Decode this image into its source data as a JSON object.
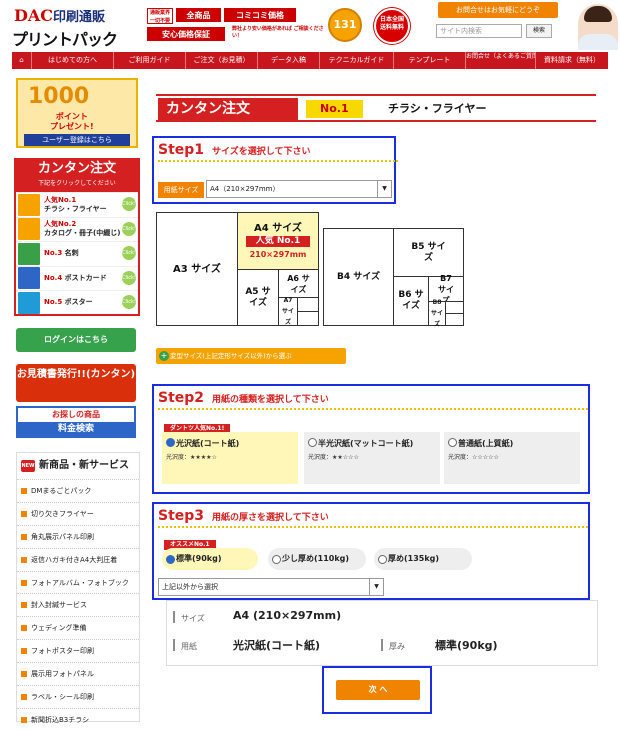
{
  "header": {
    "logo_line1_a": "DAC",
    "logo_line1_b": "印刷通販",
    "logo_line2": "プリントパック",
    "badge_small": "通販業界一切不要",
    "badge_all": "全商品",
    "badge_comikomi": "コミコミ価格",
    "badge_guarantee": "安心価格保証",
    "guarantee_note": "弊社より安い価格があれば ご相談ください！",
    "medal_number": "131",
    "medal2_text": "日本全国 送料無料",
    "contact_button": "お問合せはお気軽にどうぞ",
    "search_placeholder": "サイト内検索",
    "search_button": "検索"
  },
  "nav": {
    "items": [
      {
        "label": "はじめての方へ"
      },
      {
        "label": "ご利用ガイド"
      },
      {
        "label": "ご注文（お見積）"
      },
      {
        "label": "データ入稿"
      },
      {
        "label": "テクニカルガイド"
      },
      {
        "label": "テンプレート"
      },
      {
        "label": "お問合せ（よくあるご質問）"
      },
      {
        "label": "資料請求（無料）"
      }
    ]
  },
  "sidebar": {
    "points_number": "1000",
    "points_unit": "ポイント",
    "points_gift": "プレゼント!",
    "register_label": "ユーザー登録はこちら",
    "kantan_title": "カンタン注文",
    "kantan_sub": "下記をクリックしてください",
    "kantan_items": [
      {
        "rank": "人気No.1",
        "label": "チラシ・フライヤー"
      },
      {
        "rank": "人気No.2",
        "label": "カタログ・冊子(中綴じ)"
      },
      {
        "rank": "No.3",
        "label": "名刺"
      },
      {
        "rank": "No.4",
        "label": "ポストカード"
      },
      {
        "rank": "No.5",
        "label": "ポスター"
      }
    ],
    "click_label": "Click!",
    "login_label": "ログインはこちら",
    "quote_label": "お見積書発行!!(カンタン)",
    "search_product_a": "お探しの商品",
    "search_product_b": "料金検索",
    "new_badge": "NEW",
    "new_services_title": "新商品・新サービス",
    "new_services": [
      "DMまるごとパック",
      "切り欠きフライヤー",
      "角丸展示パネル印刷",
      "返信ハガキ付きA4大判圧着",
      "フォトアルバム・フォトブック",
      "封入封緘サービス",
      "ウェディング準備",
      "フォトポスター印刷",
      "展示用フォトパネル",
      "ラベル・シール印刷",
      "新聞折込B3チラシ"
    ]
  },
  "main": {
    "title": "カンタン注文",
    "title_badge": "No.1",
    "title_product": "チラシ・フライヤー",
    "step1": {
      "num": "Step1",
      "desc": "サイズを選択して下さい",
      "label": "用紙サイズ",
      "value": "A4（210×297mm）"
    },
    "sizes": {
      "a3": "A3 サイズ",
      "a4": "A4 サイズ",
      "a4_popular": "人気 No.1",
      "a4_mm": "210×297mm",
      "a5": "A5 サイズ",
      "a6": "A6 サイズ",
      "a7": "A7 サイズ",
      "b4": "B4 サイズ",
      "b5": "B5 サイズ",
      "b6": "B6 サイズ",
      "b7": "B7 サイズ",
      "b8": "B8 サイズ"
    },
    "variant_button": "変型サイズ(上記定形サイズ以外)から選ぶ",
    "step2": {
      "num": "Step2",
      "desc": "用紙の種類を選択して下さい",
      "ribbon": "ダントツ人気No.1!",
      "papers": [
        {
          "name": "光沢紙(コート紙)",
          "gloss": "光沢度：★★★★☆"
        },
        {
          "name": "半光沢紙(マットコート紙)",
          "gloss": "光沢度：★★☆☆☆"
        },
        {
          "name": "普通紙(上質紙)",
          "gloss": "光沢度：☆☆☆☆☆"
        }
      ]
    },
    "step3": {
      "num": "Step3",
      "desc": "用紙の厚さを選択して下さい",
      "ribbon": "オススメNo.1",
      "options": [
        "標準(90kg)",
        "少し厚め(110kg)",
        "厚め(135kg)"
      ],
      "other_select": "上記以外から選択"
    },
    "summary": {
      "size_label": "サイズ",
      "size_value": "A4 (210×297mm)",
      "paper_label": "用紙",
      "paper_value": "光沢紙(コート紙)",
      "thick_label": "厚み",
      "thick_value": "標準(90kg)"
    },
    "next_button": "次 へ"
  }
}
